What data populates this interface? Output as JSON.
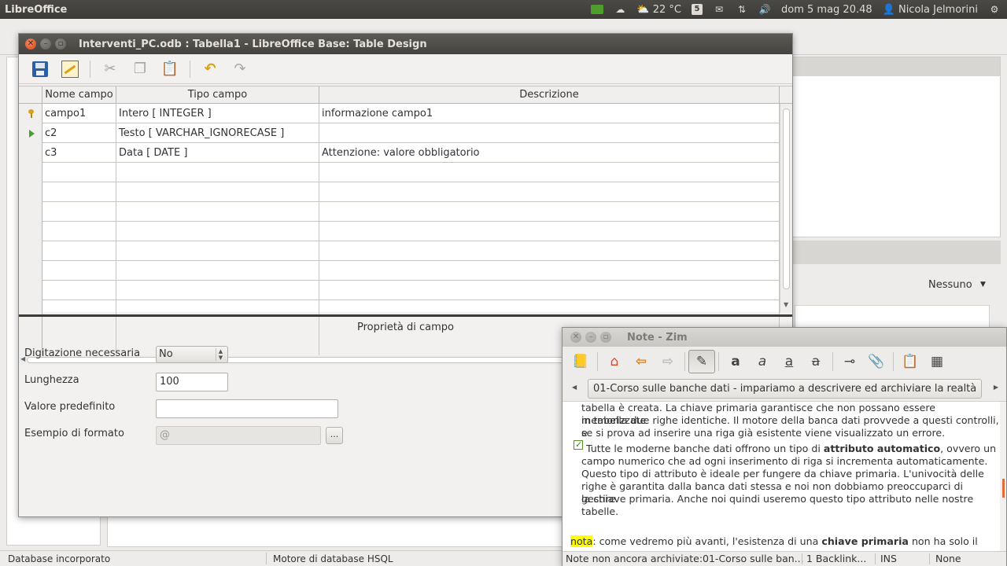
{
  "top_panel": {
    "app_title": "LibreOffice",
    "weather": "22 °C",
    "clock": "dom  5 mag 20.48",
    "user": "Nicola Jelmorini"
  },
  "background": {
    "nessuno_label": "Nessuno",
    "status_left": "Database incorporato",
    "status_right": "Motore di database HSQL"
  },
  "table_design": {
    "title": "Interventi_PC.odb : Tabella1 - LibreOffice Base: Table Design",
    "columns": [
      "Nome campo",
      "Tipo campo",
      "Descrizione"
    ],
    "rows": [
      {
        "name": "campo1",
        "type": "Intero [ INTEGER ]",
        "desc": "informazione campo1"
      },
      {
        "name": "c2",
        "type": "Testo [ VARCHAR_IGNORECASE ]",
        "desc": ""
      },
      {
        "name": "c3",
        "type": "Data [ DATE ]",
        "desc": "Attenzione: valore obbligatorio"
      }
    ],
    "properties": {
      "title": "Proprietà di campo",
      "required_label": "Digitazione necessaria",
      "required_value": "No",
      "length_label": "Lunghezza",
      "length_value": "100",
      "default_label": "Valore predefinito",
      "default_value": "",
      "format_label": "Esempio di formato",
      "format_value": "@",
      "format_button": "..."
    }
  },
  "zim": {
    "title": "Note - Zim",
    "path": "01-Corso sulle banche dati - impariamo a descrivere ed archiviare la realtà",
    "line1": "tabella è creata. La chiave primaria garantisce che non possano essere memorizzate",
    "line2": "in tabella due righe identiche. Il motore della banca dati provvede a questi controlli, e",
    "line3": "se si prova ad inserire una riga già esistente viene visualizzato un errore.",
    "p2_pre": "Tutte le moderne banche dati offrono un tipo di ",
    "p2_bold": "attributo automatico",
    "p2_post": ", ovvero un",
    "line5": "campo numerico che ad ogni inserimento di riga si incrementa automaticamente.",
    "line6": "Questo tipo di attributo è ideale per fungere da chiave primaria. L'univocità delle",
    "line7": "righe è garantita dalla banca dati stessa e noi non dobbiamo preoccuparci di gestire",
    "line8": "la chiave primaria. Anche noi quindi useremo questo tipo attributo nelle nostre",
    "line9": "tabelle.",
    "nota_hl": "nota",
    "nota_pre": ": come vedremo più avanti, l'esistenza di una ",
    "nota_bold": "chiave primaria",
    "nota_post": " non ha solo il",
    "status_note": "Note non ancora archiviate:01-Corso sulle ban...",
    "status_backlinks": "1 Backlink...",
    "status_ins": "INS",
    "status_none": "None"
  }
}
